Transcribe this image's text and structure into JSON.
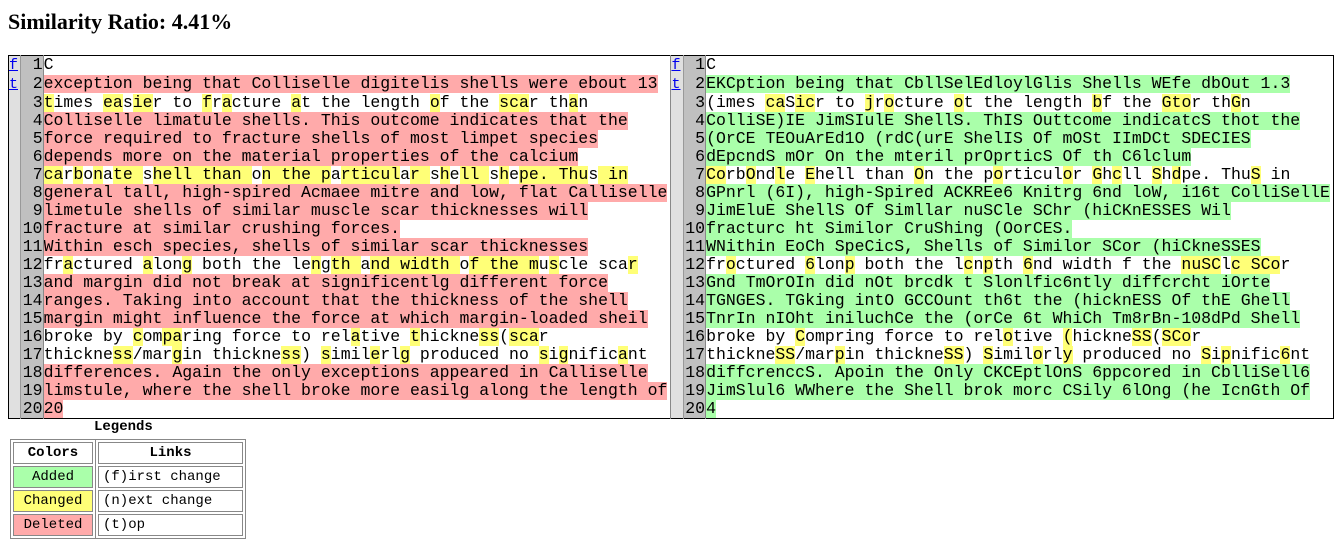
{
  "title": "Similarity Ratio: 4.41%",
  "nav_links": {
    "first": "f",
    "top": "t"
  },
  "colors": {
    "added": "#aaffaa",
    "changed": "#ffff77",
    "deleted": "#ffaaaa"
  },
  "rows": [
    {
      "n": 1,
      "kind": "eq",
      "left": [
        "C"
      ],
      "right": [
        "C"
      ]
    },
    {
      "n": 2,
      "kind": "del",
      "left": [
        "exception being that Colliselle digitelis shells were ebout 13"
      ],
      "right": [
        "EKCption being that CbllSelEdloylGlis Shells WEfe dbOut 1.3"
      ]
    },
    {
      "n": 3,
      "kind": "chg",
      "left": [
        "",
        "t",
        "imes ",
        "ea",
        "s",
        "ie",
        "r to ",
        "f",
        "r",
        "a",
        "cture ",
        "a",
        "t the length ",
        "o",
        "f the ",
        "sca",
        "r th",
        "a",
        "n"
      ],
      "right": [
        "(imes ",
        "ca",
        "S",
        "ic",
        "r to ",
        "j",
        "r",
        "o",
        "cture ",
        "o",
        "t the length ",
        "b",
        "f the ",
        "Gto",
        "r th",
        "G",
        "n"
      ]
    },
    {
      "n": 4,
      "kind": "del",
      "left": [
        "Colliselle limatule shells. This outcome indicates that the"
      ],
      "right": [
        "ColliSE)IE JimSIulE ShellS. ThIS Outtcome indicatcS thot the"
      ]
    },
    {
      "n": 5,
      "kind": "del",
      "left": [
        "force required to fracture shells of most limpet species"
      ],
      "right": [
        "(OrCE TEOuArEd1O (rdC(urE ShelIS Of mOSt IImDCt SDECIES"
      ]
    },
    {
      "n": 6,
      "kind": "del",
      "left": [
        "depends more on the material properties of the calcium"
      ],
      "right": [
        "dEpcndS mOr On the mteril prOprticS Of th C6lclum"
      ]
    },
    {
      "n": 7,
      "kind": "chg",
      "left": [
        "",
        "ca",
        "r",
        "b",
        "o",
        "n",
        "a",
        "te ",
        "s",
        "hell than ",
        "o",
        "n the p",
        "a",
        "rticul",
        "a",
        "r ",
        "s",
        "h",
        "e",
        "ll ",
        "s",
        "h",
        "e",
        "pe. Thu",
        "s",
        " in"
      ],
      "right": [
        "",
        "Co",
        "rb",
        "O",
        "nd",
        "l",
        "e ",
        "E",
        "hell than ",
        "O",
        "n the p",
        "o",
        "rticul",
        "o",
        "r ",
        "G",
        "h",
        "c",
        "ll ",
        "S",
        "h",
        "d",
        "pe. Thu",
        "S",
        " in"
      ]
    },
    {
      "n": 8,
      "kind": "del",
      "left": [
        "general tall, high-spired Acmaee mitre and low, flat Calliselle"
      ],
      "right": [
        "GPnrl (6I), high-Spired ACKREe6 Knitrg 6nd loW, i16t ColliSellE"
      ]
    },
    {
      "n": 9,
      "kind": "del",
      "left": [
        "limetule shells of similar muscle scar thicknesses will"
      ],
      "right": [
        "JimEluE ShellS Of Simllar nuSCle SChr (hiCKnESSES Wil"
      ]
    },
    {
      "n": 10,
      "kind": "del",
      "left": [
        "fracture at similar crushing forces."
      ],
      "right": [
        "fracturc ht Similor CruShing (OorCES."
      ]
    },
    {
      "n": 11,
      "kind": "del",
      "left": [
        "Within esch species, shells of similar scar thicknesses"
      ],
      "right": [
        "WNithin EoCh SpeCicS, Shells of Similor SCor (hiCkneSSES"
      ]
    },
    {
      "n": 12,
      "kind": "chg",
      "left": [
        "fr",
        "a",
        "ctured ",
        "a",
        "lon",
        "g",
        " both the le",
        "n",
        "g",
        "th ",
        "a",
        "nd width ",
        "o",
        "f the m",
        "u",
        "s",
        "cle sca",
        "r"
      ],
      "right": [
        "fr",
        "o",
        "ctured ",
        "6",
        "lon",
        "p",
        " both the l",
        "c",
        "n",
        "p",
        "th ",
        "6",
        "nd width f the ",
        "nuSC",
        "l",
        "c SCo",
        "r"
      ]
    },
    {
      "n": 13,
      "kind": "del",
      "left": [
        "and margin did not break at significentlg different force"
      ],
      "right": [
        "Gnd TmOrOIn did nOt brcdk t Slonlfic6ntly diffcrcht iOrte"
      ]
    },
    {
      "n": 14,
      "kind": "del",
      "left": [
        "ranges. Taking into account that the thickness of the shell"
      ],
      "right": [
        "TGNGES. TGking intO GCCOunt th6t the (hicknESS Of thE Ghell"
      ]
    },
    {
      "n": 15,
      "kind": "del",
      "left": [
        "margin might influence the force at which margin-loaded sheil"
      ],
      "right": [
        "TnrIn nIOht iniluchCe the (orCe 6t WhiCh Tm8rBn-108dPd Shell"
      ]
    },
    {
      "n": 16,
      "kind": "chg",
      "left": [
        "broke by ",
        "c",
        "om",
        "pa",
        "ring force to rel",
        "a",
        "tive ",
        "t",
        "hickne",
        "ss",
        "(",
        "sca",
        "r"
      ],
      "right": [
        "broke by ",
        "C",
        "ompring force to rel",
        "o",
        "tive ",
        "(",
        "hickne",
        "SS",
        "(",
        "SCo",
        "r"
      ]
    },
    {
      "n": 17,
      "kind": "chg",
      "left": [
        "thickne",
        "ss",
        "/mar",
        "g",
        "in thickne",
        "ss",
        ") ",
        "s",
        "imil",
        "e",
        "rl",
        "g",
        " produced no ",
        "s",
        "i",
        "g",
        "nific",
        "a",
        "nt"
      ],
      "right": [
        "thickne",
        "SS",
        "/mar",
        "p",
        "in thickne",
        "SS",
        ") ",
        "S",
        "imil",
        "o",
        "rl",
        "y",
        " produced no ",
        "S",
        "i",
        "p",
        "nific",
        "6",
        "nt"
      ]
    },
    {
      "n": 18,
      "kind": "del",
      "left": [
        "differences. Again the only exceptions appeared in Calliselle"
      ],
      "right": [
        "diffcrenccS. Apoin the Only CKCEptlOnS 6ppcored in CblliSell6"
      ]
    },
    {
      "n": 19,
      "kind": "del",
      "left": [
        "limstule, where the shell broke more easilg along the length of"
      ],
      "right": [
        "JimSlul6 WWhere the Shell brok morc CSily 6lOng (he IcnGth Of"
      ]
    },
    {
      "n": 20,
      "kind": "del",
      "left": [
        "20"
      ],
      "right": [
        "4"
      ]
    }
  ],
  "legend": {
    "title": "Legends",
    "colors_header": "Colors",
    "added": "Added",
    "changed": "Changed",
    "deleted": "Deleted",
    "links_header": "Links",
    "first": "(f)irst change",
    "next": "(n)ext change",
    "top": "(t)op"
  }
}
